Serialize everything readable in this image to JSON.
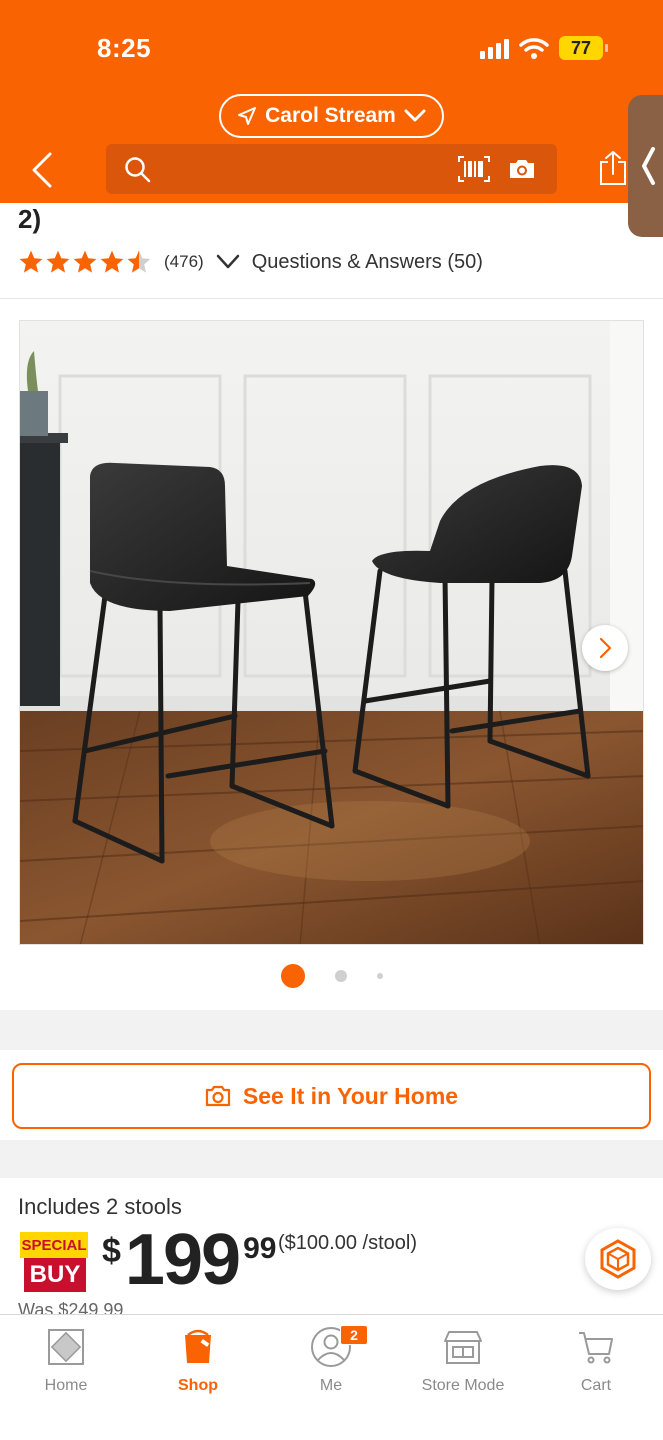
{
  "status_bar": {
    "time": "8:25",
    "battery": "77"
  },
  "header": {
    "store": "Carol Stream",
    "search": {
      "placeholder": ""
    }
  },
  "product": {
    "title_fragment": "2)",
    "rating": 4.5,
    "review_count": "(476)",
    "qa_link": "Questions & Answers (50)",
    "image_alt": "Black faux leather counter stools set of 2",
    "gallery": {
      "total": 3,
      "active_index": 0
    }
  },
  "see_it_button": "See It in Your Home",
  "pricing": {
    "includes": "Includes 2 stools",
    "badge_top": "SPECIAL",
    "badge_bottom": "BUY",
    "currency": "$",
    "dollars": "199",
    "cents": "99",
    "unit_price": "($100.00 /stool)",
    "was_fragment": "Was $249.99"
  },
  "bottom_nav": {
    "items": [
      {
        "label": "Home",
        "icon": "home-depot-logo-icon"
      },
      {
        "label": "Shop",
        "icon": "shop-bucket-icon",
        "active": true
      },
      {
        "label": "Me",
        "icon": "user-icon",
        "badge": "2"
      },
      {
        "label": "Store Mode",
        "icon": "store-icon"
      },
      {
        "label": "Cart",
        "icon": "cart-icon"
      }
    ]
  },
  "colors": {
    "brand_orange": "#f96302",
    "special_yellow": "#ffd600",
    "special_red": "#c8102e"
  }
}
